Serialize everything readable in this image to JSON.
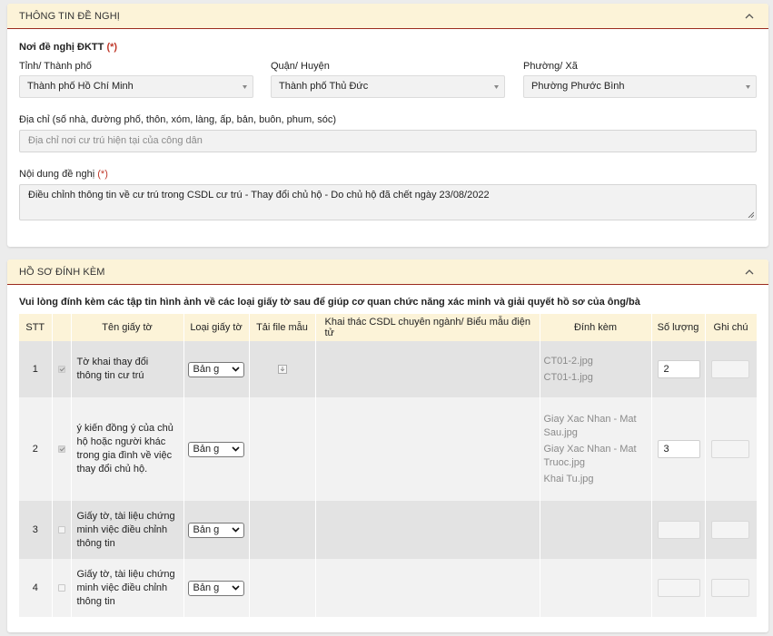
{
  "section1": {
    "title": "THÔNG TIN ĐỀ NGHỊ",
    "place_label": "Nơi đề nghị ĐKTT",
    "required_mark": "(*)",
    "province": {
      "label": "Tỉnh/ Thành phố",
      "value": "Thành phố Hồ Chí Minh"
    },
    "district": {
      "label": "Quận/ Huyện",
      "value": "Thành phố Thủ Đức"
    },
    "ward": {
      "label": "Phường/ Xã",
      "value": "Phường Phước Bình"
    },
    "address": {
      "label": "Địa chỉ (số nhà, đường phố, thôn, xóm, làng, ấp, bản, buôn, phum, sóc)",
      "placeholder": "Địa chỉ nơi cư trú hiện tại của công dân"
    },
    "content": {
      "label": "Nội dung đề nghị",
      "value": "Điều chỉnh thông tin về cư trú trong CSDL cư trú - Thay đổi chủ hộ - Do chủ hộ đã chết ngày 23/08/2022"
    }
  },
  "section2": {
    "title": "HỒ SƠ ĐÍNH KÈM",
    "instruction": "Vui lòng đính kèm các tập tin hình ảnh về các loại giấy tờ sau để giúp cơ quan chức năng xác minh và giải quyết hồ sơ của ông/bà",
    "headers": {
      "stt": "STT",
      "name": "Tên giấy tờ",
      "type": "Loại giấy tờ",
      "template": "Tải file mẫu",
      "csdl": "Khai thác CSDL chuyên ngành/ Biểu mẫu điện tử",
      "attach": "Đính kèm",
      "qty": "Số lượng",
      "note": "Ghi chú"
    },
    "rows": [
      {
        "stt": "1",
        "name": "Tờ khai thay đổi thông tin cư trú",
        "type": "Bản g",
        "files": [
          "CT01-2.jpg",
          "CT01-1.jpg"
        ],
        "qty": "2"
      },
      {
        "stt": "2",
        "name": "ý kiến đồng ý của chủ hộ hoặc người khác trong gia đình về việc thay đổi chủ hộ.",
        "type": "Bản g",
        "files": [
          "Giay Xac Nhan - Mat Sau.jpg",
          "Giay Xac Nhan - Mat Truoc.jpg",
          "Khai Tu.jpg"
        ],
        "qty": "3"
      },
      {
        "stt": "3",
        "name": "Giấy tờ, tài liệu chứng minh việc điều chỉnh thông tin",
        "type": "Bản g"
      },
      {
        "stt": "4",
        "name": "Giấy tờ, tài liệu chứng minh việc điều chỉnh thông tin",
        "type": "Bản g"
      }
    ]
  },
  "colors": {
    "header_bg": "#fcf3d8",
    "header_line": "#9b2b1f",
    "required": "#c0392b"
  },
  "icons": {
    "collapse": "chevron-up-icon",
    "dropdown": "caret-down-icon",
    "download": "download-icon"
  }
}
